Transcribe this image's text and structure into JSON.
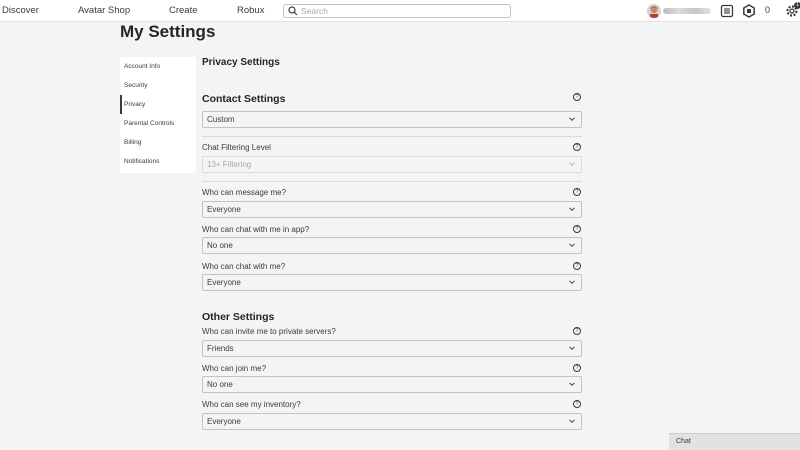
{
  "nav": {
    "links": [
      "Discover",
      "Avatar Shop",
      "Create",
      "Robux"
    ],
    "search_placeholder": "Search",
    "robux_count": "0",
    "notification_count": "1"
  },
  "page": {
    "title": "My Settings"
  },
  "menu": {
    "items": [
      "Account Info",
      "Security",
      "Privacy",
      "Parental Controls",
      "Billing",
      "Notifications"
    ],
    "active": "Privacy"
  },
  "privacy": {
    "heading": "Privacy Settings",
    "contact": {
      "heading": "Contact Settings",
      "value": "Custom",
      "filter_label": "Chat Filtering Level",
      "filter_value": "13+ Filtering",
      "message_label": "Who can message me?",
      "message_value": "Everyone",
      "chat_app_label": "Who can chat with me in app?",
      "chat_app_value": "No one",
      "chat_label": "Who can chat with me?",
      "chat_value": "Everyone"
    },
    "other": {
      "heading": "Other Settings",
      "invite_label": "Who can invite me to private servers?",
      "invite_value": "Friends",
      "join_label": "Who can join me?",
      "join_value": "No one",
      "inventory_label": "Who can see my inventory?",
      "inventory_value": "Everyone"
    }
  },
  "chat": {
    "label": "Chat"
  },
  "colors": {
    "background": "#f2f4f5",
    "panel": "#ffffff",
    "text": "#393b3d"
  }
}
